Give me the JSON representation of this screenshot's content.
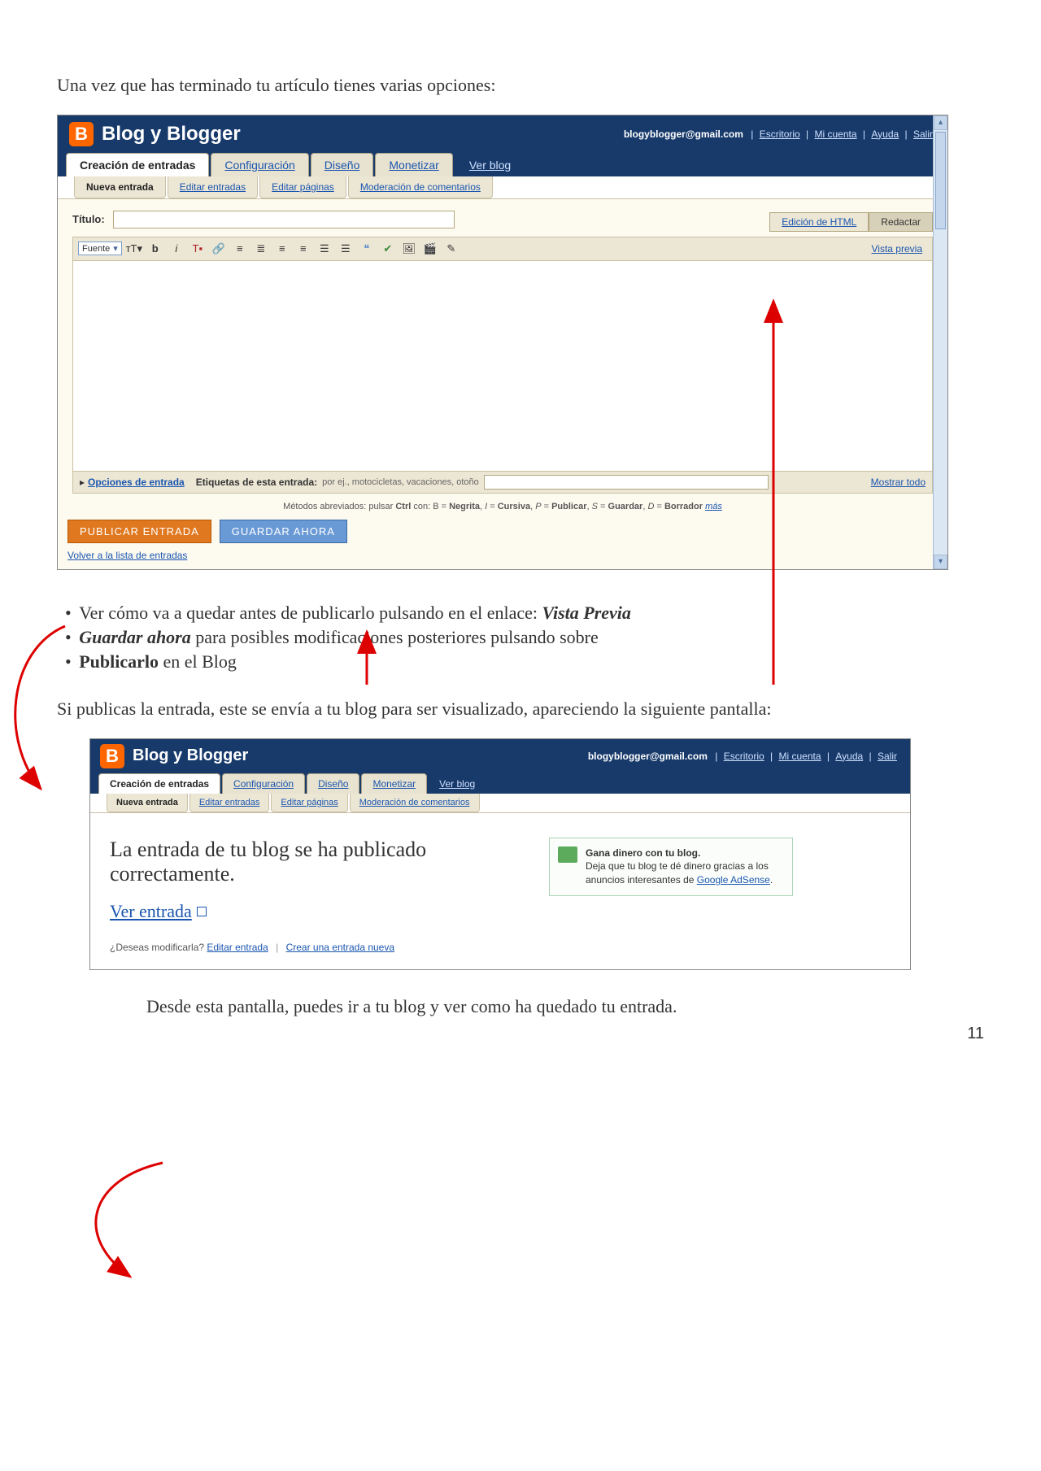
{
  "doc": {
    "intro": "Una vez que has terminado tu artículo tienes varias opciones:",
    "bullets": {
      "b1_pre": "Ver cómo va a quedar antes de publicarlo pulsando en el enlace: ",
      "b1_em": "Vista Previa",
      "b2_em": "Guardar ahora",
      "b2_post": " para posibles modificaciones posteriores pulsando sobre",
      "b3_bold": "Publicarlo",
      "b3_post": " en el Blog"
    },
    "middle": "Si publicas la entrada, este se envía a tu blog para ser visualizado, apareciendo la siguiente pantalla:",
    "closing": "Desde esta pantalla, puedes ir a tu blog y ver como ha quedado tu entrada.",
    "page": "11"
  },
  "header": {
    "logo": "B",
    "title": "Blog y Blogger",
    "email": "blogyblogger@gmail.com",
    "links": {
      "escritorio": "Escritorio",
      "micuenta": "Mi cuenta",
      "ayuda": "Ayuda",
      "salir": "Salir"
    }
  },
  "tabs": {
    "creacion": "Creación de entradas",
    "config": "Configuración",
    "diseno": "Diseño",
    "monetizar": "Monetizar",
    "verblog": "Ver blog"
  },
  "subtabs": {
    "nueva": "Nueva entrada",
    "editar_entradas": "Editar entradas",
    "editar_paginas": "Editar páginas",
    "moderacion": "Moderación de comentarios"
  },
  "editor": {
    "titulo_label": "Título:",
    "edicion_html": "Edición de HTML",
    "redactar": "Redactar",
    "fuente": "Fuente",
    "vista_previa": "Vista previa",
    "opciones": "Opciones de entrada",
    "etiquetas_label": "Etiquetas de esta entrada:",
    "etiquetas_hint": "por ej., motocicletas, vacaciones, otoño",
    "mostrar_todo": "Mostrar todo",
    "shortcuts_pre": "Métodos abreviados: pulsar ",
    "shortcuts_ctrl": "Ctrl",
    "shortcuts_mid": " con: B = ",
    "sc_negrita": "Negrita",
    "sc_cursiva": "Cursiva",
    "sc_publicar": "Publicar",
    "sc_guardar": "Guardar",
    "sc_borrador": "Borrador",
    "mas": "más",
    "publicar": "PUBLICAR ENTRADA",
    "guardar": "GUARDAR AHORA",
    "volver": "Volver a la lista de entradas"
  },
  "shot2": {
    "published": "La entrada de tu blog se ha publicado correctamente.",
    "ver_entrada": "Ver entrada",
    "modify_q": "¿Deseas modificarla?",
    "editar_entrada": "Editar entrada",
    "crear_nueva": "Crear una entrada nueva",
    "ad_title": "Gana dinero con tu blog.",
    "ad_body": "Deja que tu blog te dé dinero gracias a los anuncios interesantes de ",
    "ad_link": "Google AdSense"
  }
}
